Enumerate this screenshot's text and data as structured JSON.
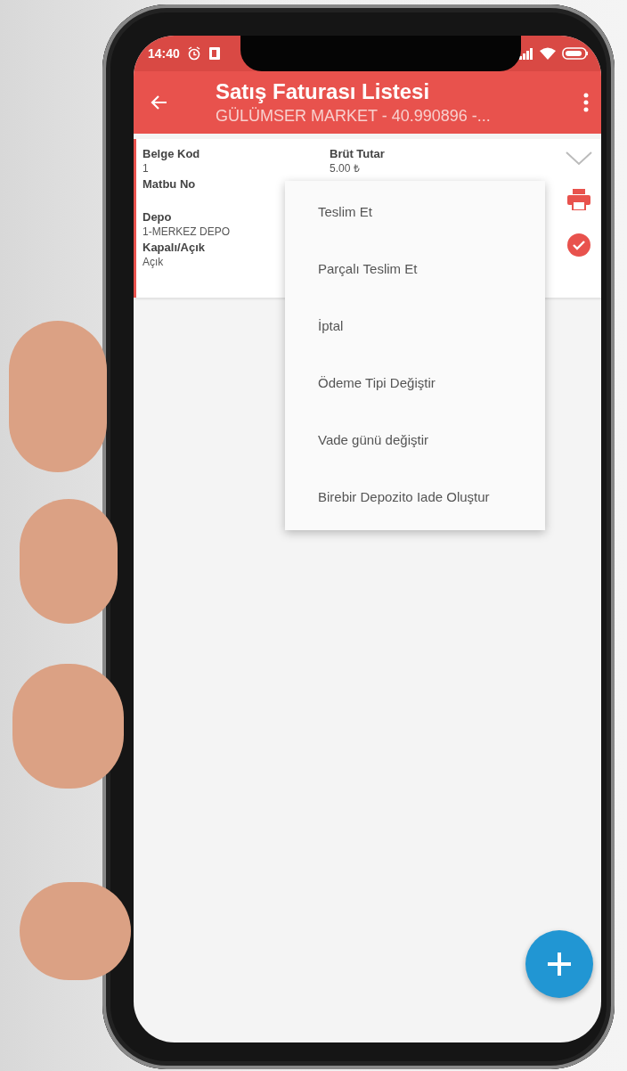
{
  "status_bar": {
    "time": "14:40"
  },
  "app_bar": {
    "title": "Satış Faturası Listesi",
    "subtitle": "GÜLÜMSER MARKET -   40.990896 -..."
  },
  "invoice": {
    "left_fields": [
      {
        "label": "Belge Kod",
        "value": "1"
      },
      {
        "label": "Matbu No"
      },
      {
        "label": "Depo",
        "value": "1-MERKEZ DEPO"
      },
      {
        "label": "Kapalı/Açık",
        "value": "Açık"
      }
    ],
    "right_fields": [
      {
        "label": "Brüt Tutar",
        "value": "5.00 ₺"
      }
    ]
  },
  "menu": {
    "items": [
      {
        "label": "Teslim Et"
      },
      {
        "label": "Parçalı Teslim Et"
      },
      {
        "label": "İptal"
      },
      {
        "label": "Ödeme Tipi Değiştir"
      },
      {
        "label": "Vade günü değiştir"
      },
      {
        "label": "Birebir Depozito Iade Oluştur"
      }
    ]
  }
}
